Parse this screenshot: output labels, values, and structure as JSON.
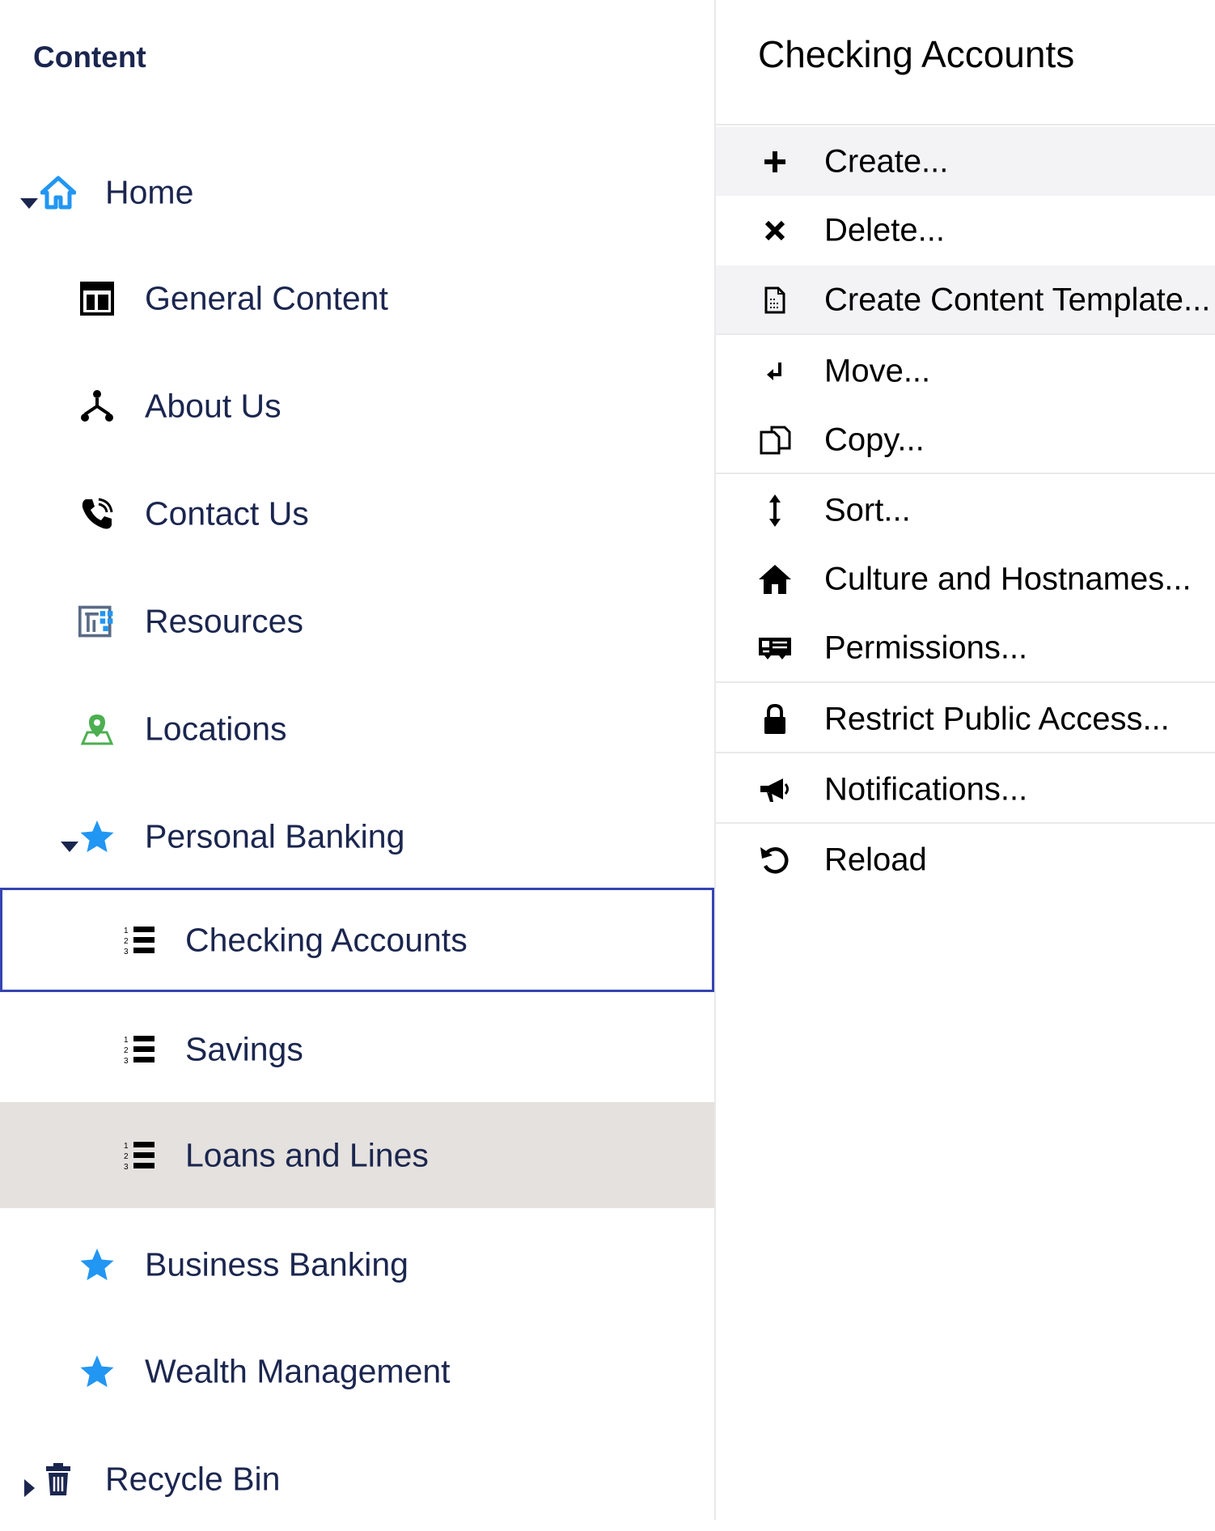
{
  "tree": {
    "title": "Content",
    "items": [
      {
        "label": "Home",
        "icon": "home-icon",
        "expanded": true
      },
      {
        "label": "General Content",
        "icon": "layout-icon"
      },
      {
        "label": "About Us",
        "icon": "sitemap-icon"
      },
      {
        "label": "Contact Us",
        "icon": "phone-icon"
      },
      {
        "label": "Resources",
        "icon": "resources-icon"
      },
      {
        "label": "Locations",
        "icon": "map-pin-icon"
      },
      {
        "label": "Personal Banking",
        "icon": "star-icon",
        "expanded": true
      },
      {
        "label": "Checking Accounts",
        "icon": "numbered-list-icon",
        "selected": true
      },
      {
        "label": "Savings",
        "icon": "numbered-list-icon"
      },
      {
        "label": "Loans and Lines",
        "icon": "numbered-list-icon",
        "hovered": true
      },
      {
        "label": "Business Banking",
        "icon": "star-icon"
      },
      {
        "label": "Wealth Management",
        "icon": "star-icon"
      },
      {
        "label": "Recycle Bin",
        "icon": "trash-icon",
        "expanded": false
      }
    ]
  },
  "menu": {
    "title": "Checking Accounts",
    "items": [
      {
        "label": "Create...",
        "icon": "plus-icon"
      },
      {
        "label": "Delete...",
        "icon": "close-icon"
      },
      {
        "label": "Create Content Template...",
        "icon": "template-icon"
      },
      {
        "label": "Move...",
        "icon": "move-icon"
      },
      {
        "label": "Copy...",
        "icon": "copy-icon"
      },
      {
        "label": "Sort...",
        "icon": "sort-icon"
      },
      {
        "label": "Culture and Hostnames...",
        "icon": "home-icon"
      },
      {
        "label": "Permissions...",
        "icon": "permissions-icon"
      },
      {
        "label": "Restrict Public Access...",
        "icon": "lock-icon"
      },
      {
        "label": "Notifications...",
        "icon": "megaphone-icon"
      },
      {
        "label": "Reload",
        "icon": "reload-icon"
      }
    ]
  },
  "colors": {
    "text": "#1b264f",
    "accent_blue": "#2196f3",
    "selected_border": "#3544b1",
    "hover_bg": "#e4e1de",
    "menu_highlight": "#f3f3f5",
    "location_green": "#4caf50"
  }
}
